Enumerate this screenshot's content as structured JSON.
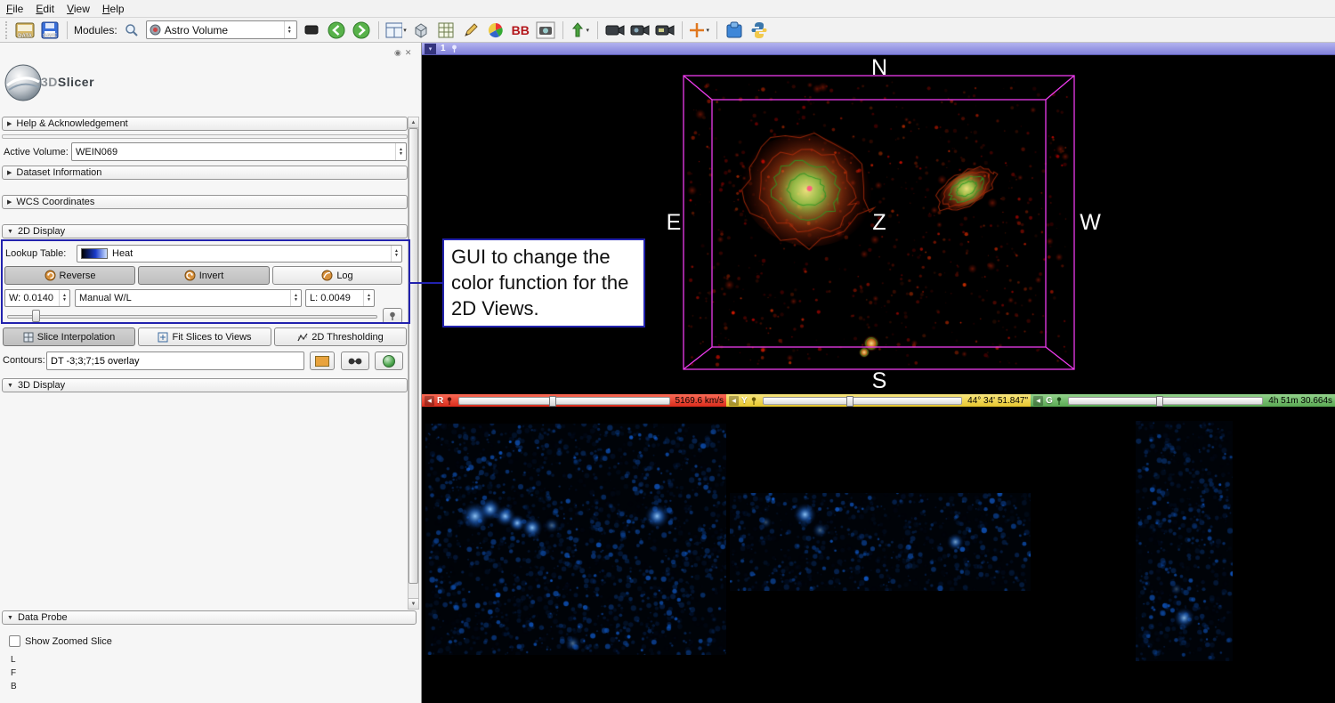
{
  "colors": {
    "accent_blue": "#2222ae",
    "wireframe_magenta": "#ec3bec",
    "slice_red": "#e8392a",
    "slice_yellow": "#edd049",
    "slice_green": "#6cbf68",
    "titlebar_purple": "#8181da"
  },
  "menubar": {
    "items": [
      "File",
      "Edit",
      "View",
      "Help"
    ]
  },
  "toolbar": {
    "load_label": "DATA",
    "save_label": "SAVE",
    "modules_label": "Modules:",
    "module_value": "Astro Volume",
    "bb_icon_text": "BB"
  },
  "sidebar": {
    "logo_text_3d": "3D",
    "logo_text_slicer": "Slicer",
    "help_section": "Help & Acknowledgement",
    "active_volume_label": "Active Volume:",
    "active_volume_value": "WEIN069",
    "dataset_section": "Dataset Information",
    "wcs_section": "WCS Coordinates",
    "d2_section": "2D Display",
    "lookup_table_label": "Lookup Table:",
    "lookup_table_value": "Heat",
    "reverse_button": "Reverse",
    "invert_button": "Invert",
    "log_button": "Log",
    "window_label": "W:",
    "window_value": "0.0140",
    "wl_mode_value": "Manual W/L",
    "level_label": "L:",
    "level_value": "0.0049",
    "slice_interpolation_button": "Slice Interpolation",
    "fit_slices_button": "Fit Slices to Views",
    "thresholding_button": "2D Thresholding",
    "contours_label": "Contours:",
    "contours_value": "DT -3;3;7;15 overlay",
    "d3_section": "3D Display",
    "data_probe_section": "Data Probe",
    "show_zoomed_slice": "Show Zoomed Slice",
    "probe_rows": [
      "L",
      "F",
      "B"
    ]
  },
  "annotation": {
    "text": "GUI to change the color function for the 2D Views."
  },
  "view3d": {
    "index_label": "1",
    "compass": {
      "n": "N",
      "e": "E",
      "z": "Z",
      "w": "W",
      "s": "S"
    }
  },
  "slices": [
    {
      "letter": "R",
      "value": "5169.6 km/s",
      "color": "#e8392a"
    },
    {
      "letter": "Y",
      "value": "44° 34' 51.847\"",
      "color": "#edd049"
    },
    {
      "letter": "G",
      "value": "4h 51m 30.664s",
      "color": "#6cbf68"
    }
  ]
}
